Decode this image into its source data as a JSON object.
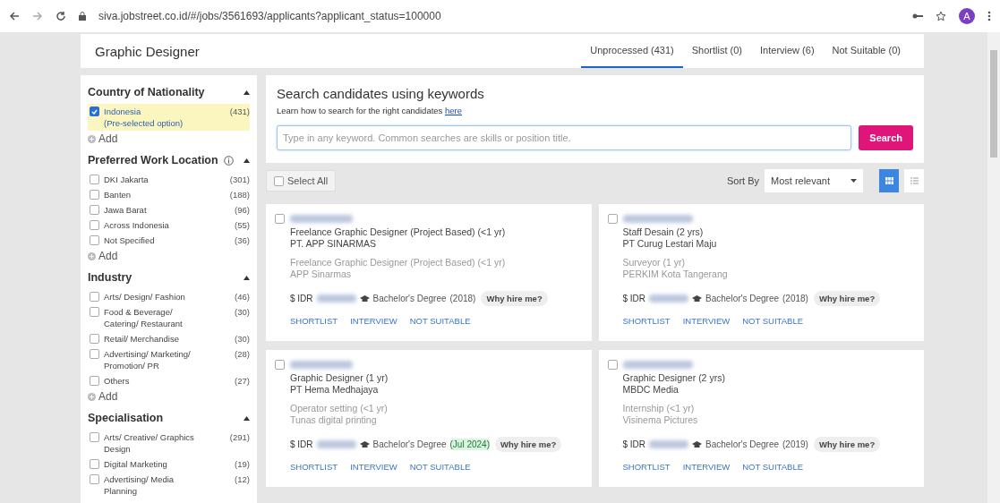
{
  "browser": {
    "url": "siva.jobstreet.co.id/#/jobs/3561693/applicants?applicant_status=100000",
    "avatar": "A"
  },
  "header": {
    "title": "Graphic Designer",
    "tabs": [
      {
        "label": "Unprocessed (431)",
        "selected": true
      },
      {
        "label": "Shortlist (0)",
        "selected": false
      },
      {
        "label": "Interview (6)",
        "selected": false
      },
      {
        "label": "Not Suitable (0)",
        "selected": false
      }
    ]
  },
  "filters": [
    {
      "title": "Country of Nationality",
      "add": "Add",
      "options": [
        {
          "label": "Indonesia",
          "note": "(Pre-selected option)",
          "count": "(431)",
          "checked": true
        }
      ]
    },
    {
      "title": "Preferred Work Location",
      "info": true,
      "add": "Add",
      "options": [
        {
          "label": "DKI Jakarta",
          "count": "(301)",
          "checked": false
        },
        {
          "label": "Banten",
          "count": "(188)",
          "checked": false
        },
        {
          "label": "Jawa Barat",
          "count": "(96)",
          "checked": false
        },
        {
          "label": "Across Indonesia",
          "count": "(55)",
          "checked": false
        },
        {
          "label": "Not Specified",
          "count": "(36)",
          "checked": false
        }
      ]
    },
    {
      "title": "Industry",
      "add": "Add",
      "options": [
        {
          "label": "Arts/ Design/ Fashion",
          "count": "(46)",
          "checked": false
        },
        {
          "label": "Food & Beverage/ Catering/ Restaurant",
          "count": "(30)",
          "checked": false
        },
        {
          "label": "Retail/ Merchandise",
          "count": "(30)",
          "checked": false
        },
        {
          "label": "Advertising/ Marketing/ Promotion/ PR",
          "count": "(28)",
          "checked": false
        },
        {
          "label": "Others",
          "count": "(27)",
          "checked": false
        }
      ]
    },
    {
      "title": "Specialisation",
      "options": [
        {
          "label": "Arts/ Creative/ Graphics Design",
          "count": "(291)",
          "checked": false
        },
        {
          "label": "Digital Marketing",
          "count": "(19)",
          "checked": false
        },
        {
          "label": "Advertising/ Media Planning",
          "count": "(12)",
          "checked": false
        }
      ]
    }
  ],
  "search": {
    "title": "Search candidates using keywords",
    "hint": "Learn how to search for the right candidates",
    "link": "here",
    "placeholder": "Type in any keyword. Common searches are skills or position title.",
    "button": "Search"
  },
  "toolbar": {
    "select_all": "Select All",
    "sort_label": "Sort By",
    "sort_value": "Most relevant",
    "views": [
      {
        "kind": "grid",
        "selected": true
      },
      {
        "kind": "list",
        "selected": false
      }
    ]
  },
  "candidates": [
    {
      "checked": false,
      "role": "Freelance Graphic Designer (Project Based)",
      "duration": "(<1 yr)",
      "company": "PT. APP SINARMAS",
      "past_role": "Freelance Graphic Designer (Project Based)",
      "past_duration": "(<1 yr)",
      "past_company": "APP Sinarmas",
      "currency": "$ IDR",
      "degree": "Bachelor's Degree",
      "year": "(2018)",
      "year_highlight": false,
      "why": "Why hire me?",
      "actions": [
        "SHORTLIST",
        "INTERVIEW",
        "NOT SUITABLE"
      ]
    },
    {
      "checked": false,
      "role": "Staff Desain",
      "duration": "(2 yrs)",
      "company": "PT Curug Lestari Maju",
      "past_role": "Surveyor",
      "past_duration": "(1 yr)",
      "past_company": "PERKIM Kota Tangerang",
      "currency": "$ IDR",
      "degree": "Bachelor's Degree",
      "year": "(2018)",
      "year_highlight": false,
      "why": "Why hire me?",
      "actions": [
        "SHORTLIST",
        "INTERVIEW",
        "NOT SUITABLE"
      ]
    },
    {
      "checked": false,
      "role": "Graphic Designer",
      "duration": "(1 yr)",
      "company": "PT Hema Medhajaya",
      "past_role": "Operator setting",
      "past_duration": "(<1 yr)",
      "past_company": "Tunas digital printing",
      "currency": "$ IDR",
      "degree": "Bachelor's Degree",
      "year": "(Jul 2024)",
      "year_highlight": true,
      "why": "Why hire me?",
      "actions": [
        "SHORTLIST",
        "INTERVIEW",
        "NOT SUITABLE"
      ]
    },
    {
      "checked": false,
      "role": "Graphic Designer",
      "duration": "(2 yrs)",
      "company": "MBDC Media",
      "past_role": "Internship",
      "past_duration": "(<1 yr)",
      "past_company": "Visinema Pictures",
      "currency": "$ IDR",
      "degree": "Bachelor's Degree",
      "year": "(2019)",
      "year_highlight": false,
      "why": "Why hire me?",
      "actions": [
        "SHORTLIST",
        "INTERVIEW",
        "NOT SUITABLE"
      ]
    }
  ]
}
